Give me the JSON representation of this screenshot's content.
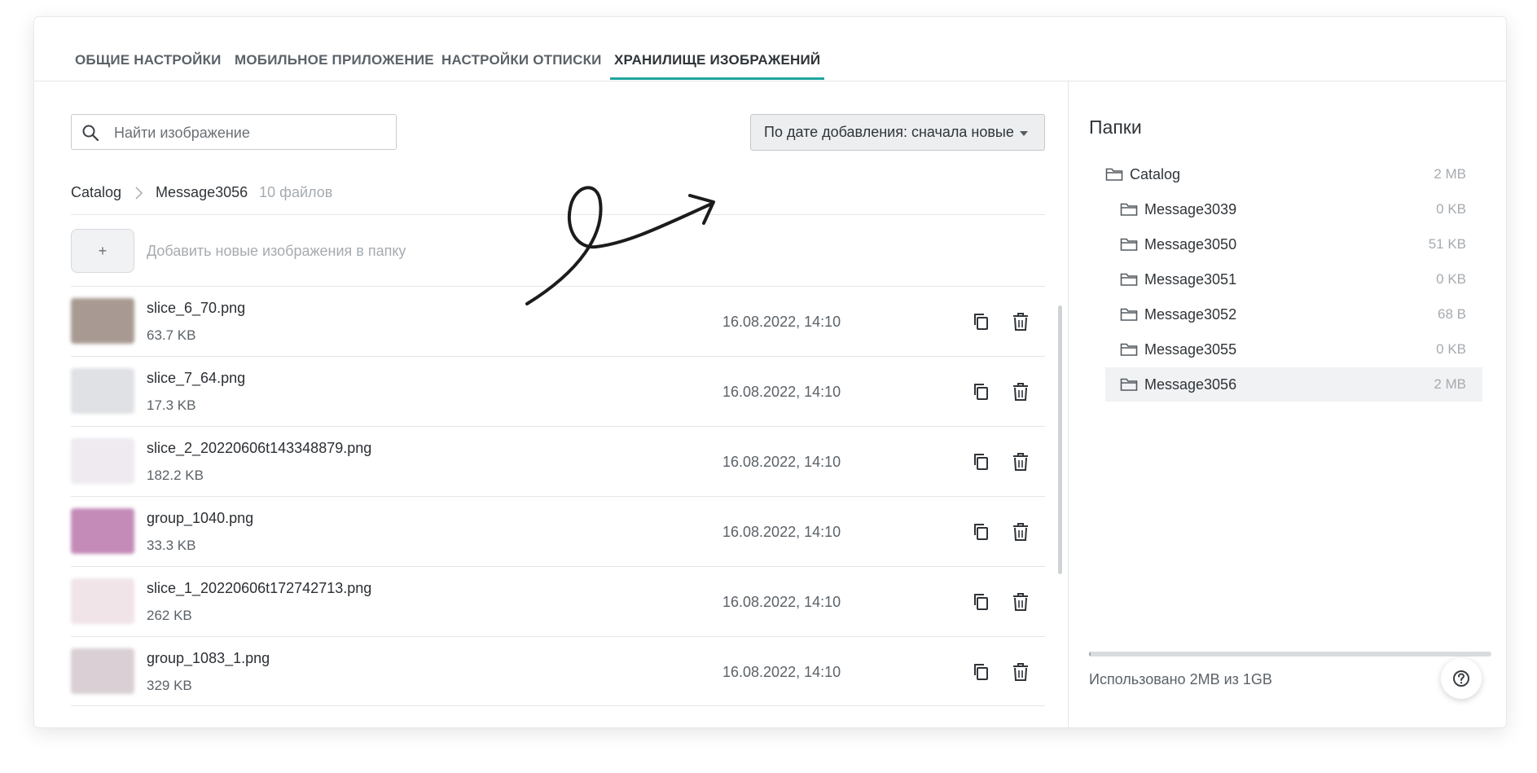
{
  "tabs": [
    {
      "label": "ОБЩИЕ НАСТРОЙКИ"
    },
    {
      "label": "МОБИЛЬНОЕ ПРИЛОЖЕНИЕ"
    },
    {
      "label": "НАСТРОЙКИ ОТПИСКИ"
    },
    {
      "label": "ХРАНИЛИЩЕ ИЗОБРАЖЕНИЙ",
      "active": true
    }
  ],
  "search": {
    "placeholder": "Найти изображение",
    "value": ""
  },
  "sort": {
    "label": "По дате добавления: сначала новые"
  },
  "breadcrumb": {
    "root": "Catalog",
    "current": "Message3056",
    "count": "10 файлов"
  },
  "add": {
    "button": "+",
    "text": "Добавить новые изображения в папку"
  },
  "files": [
    {
      "name": "slice_6_70.png",
      "size": "63.7 KB",
      "date": "16.08.2022, 14:10",
      "thumb_color": "#a89a92"
    },
    {
      "name": "slice_7_64.png",
      "size": "17.3 KB",
      "date": "16.08.2022, 14:10",
      "thumb_color": "#dfe1e4"
    },
    {
      "name": "slice_2_20220606t143348879.png",
      "size": "182.2 KB",
      "date": "16.08.2022, 14:10",
      "thumb_color": "#eeeaf0"
    },
    {
      "name": "group_1040.png",
      "size": "33.3 KB",
      "date": "16.08.2022, 14:10",
      "thumb_color": "#c48bb8"
    },
    {
      "name": "slice_1_20220606t172742713.png",
      "size": "262 KB",
      "date": "16.08.2022, 14:10",
      "thumb_color": "#f0e4e8"
    },
    {
      "name": "group_1083_1.png",
      "size": "329 KB",
      "date": "16.08.2022, 14:10",
      "thumb_color": "#d9cfd4"
    }
  ],
  "folders": {
    "title": "Папки",
    "items": [
      {
        "name": "Catalog",
        "size": "2 MB",
        "level": 0
      },
      {
        "name": "Message3039",
        "size": "0 KB",
        "level": 1
      },
      {
        "name": "Message3050",
        "size": "51 KB",
        "level": 1
      },
      {
        "name": "Message3051",
        "size": "0 KB",
        "level": 1
      },
      {
        "name": "Message3052",
        "size": "68 B",
        "level": 1
      },
      {
        "name": "Message3055",
        "size": "0 KB",
        "level": 1
      },
      {
        "name": "Message3056",
        "size": "2 MB",
        "level": 1,
        "selected": true
      }
    ]
  },
  "storage": {
    "text": "Использовано 2MB из 1GB",
    "used_fraction": 0.002
  },
  "colors": {
    "accent": "#1fa5a0"
  }
}
